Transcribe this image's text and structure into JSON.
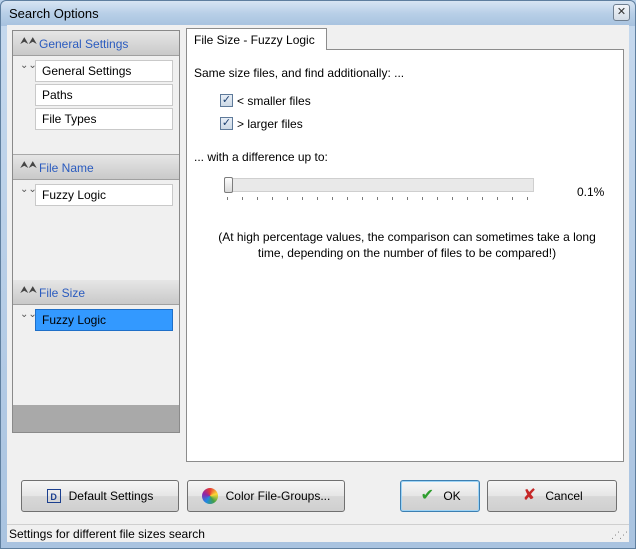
{
  "window": {
    "title": "Search Options",
    "close_glyph": "✕"
  },
  "nav": {
    "sections": [
      {
        "header": "General Settings",
        "items": [
          "General Settings",
          "Paths",
          "File Types"
        ]
      },
      {
        "header": "File Name",
        "items": [
          "Fuzzy Logic"
        ]
      },
      {
        "header": "File Size",
        "items": [
          "Fuzzy Logic"
        ]
      }
    ],
    "selected": "File Size / Fuzzy Logic"
  },
  "tab": {
    "label": "File Size - Fuzzy Logic"
  },
  "panel": {
    "intro": "Same size files, and find additionally: ...",
    "smaller": {
      "label": "< smaller files",
      "checked": true
    },
    "larger": {
      "label": "> larger files",
      "checked": true
    },
    "difference_label": "... with a difference up to:",
    "slider_value_text": "0.1%",
    "slider_fraction": 0.0,
    "note_line1": "(At high percentage values, the comparison can sometimes take a long",
    "note_line2": "time, depending on the number of files to be compared!)"
  },
  "buttons": {
    "default_settings": "Default Settings",
    "color_file_groups": "Color File-Groups...",
    "ok": "OK",
    "cancel": "Cancel"
  },
  "icons": {
    "collapse": "double-chevron-up-icon",
    "expand": "double-chevron-down-icon",
    "default_settings": "default-settings-icon",
    "color_groups": "color-wheel-icon",
    "ok": "green-check-icon",
    "cancel": "red-x-icon"
  },
  "status": {
    "text": "Settings for different file sizes search"
  },
  "colors": {
    "accent_link": "#2a5bbf",
    "selection": "#3399ff",
    "ok_green": "#2e9e2e",
    "cancel_red": "#c62828"
  }
}
